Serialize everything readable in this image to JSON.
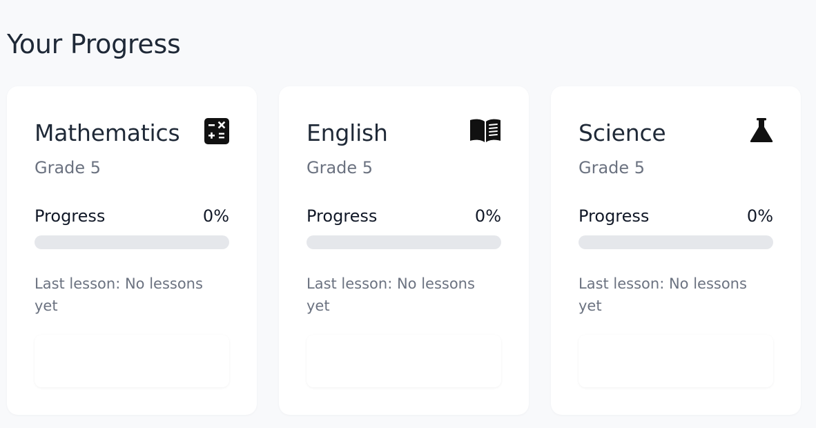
{
  "page": {
    "title": "Your Progress"
  },
  "colors": {
    "background": "#f8f9fb",
    "card": "#ffffff",
    "track": "#e5e7eb",
    "muted_text": "#6b7280",
    "heading_text": "#1f2937"
  },
  "subjects": [
    {
      "name": "Mathematics",
      "icon": "calculator-icon",
      "grade": "Grade 5",
      "progress_label": "Progress",
      "progress_value": "0%",
      "progress_fraction": 0,
      "last_lesson": "Last lesson: No lessons yet"
    },
    {
      "name": "English",
      "icon": "book-open-icon",
      "grade": "Grade 5",
      "progress_label": "Progress",
      "progress_value": "0%",
      "progress_fraction": 0,
      "last_lesson": "Last lesson: No lessons yet"
    },
    {
      "name": "Science",
      "icon": "flask-icon",
      "grade": "Grade 5",
      "progress_label": "Progress",
      "progress_value": "0%",
      "progress_fraction": 0,
      "last_lesson": "Last lesson: No lessons yet"
    }
  ]
}
